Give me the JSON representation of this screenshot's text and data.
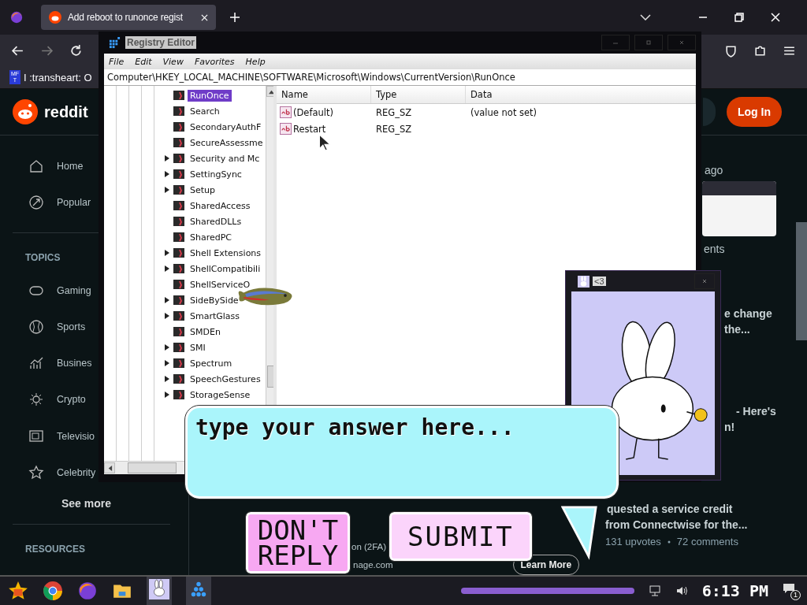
{
  "browser": {
    "tab_title": "Add reboot to runonce regist",
    "bookmark_badge": "MF T",
    "bookmark": "I :transheart: O"
  },
  "reddit": {
    "logo": "reddit",
    "login": "Log In",
    "nav": [
      {
        "label": "Home"
      },
      {
        "label": "Popular"
      }
    ],
    "topics_title": "TOPICS",
    "topics": [
      {
        "label": "Gaming"
      },
      {
        "label": "Sports"
      },
      {
        "label": "Busines"
      },
      {
        "label": "Crypto"
      },
      {
        "label": "Televisio"
      },
      {
        "label": "Celebrity"
      }
    ],
    "see_more": "See more",
    "resources_title": "RESOURCES",
    "feed_fragments": [
      {
        "text": "ago"
      },
      {
        "text": "ents"
      },
      {
        "text": "e change"
      },
      {
        "text": "the..."
      },
      {
        "text": "- Here's"
      },
      {
        "text": "n!"
      },
      {
        "text": "quested a service credit"
      },
      {
        "text": "from Connectwise for the..."
      }
    ],
    "feed_meta": [
      "131 upvotes",
      "72 comments"
    ],
    "ad": {
      "line": "on (2FA)",
      "domain": "nage.com",
      "button": "Learn More"
    }
  },
  "registry": {
    "title": "Registry Editor",
    "menu": [
      "File",
      "Edit",
      "View",
      "Favorites",
      "Help"
    ],
    "address": "Computer\\HKEY_LOCAL_MACHINE\\SOFTWARE\\Microsoft\\Windows\\CurrentVersion\\RunOnce",
    "tree": [
      {
        "label": "RunOnce",
        "expandable": false,
        "selected": true
      },
      {
        "label": "Search",
        "expandable": false,
        "selected": false
      },
      {
        "label": "SecondaryAuthF",
        "expandable": false,
        "selected": false
      },
      {
        "label": "SecureAssessme",
        "expandable": false,
        "selected": false
      },
      {
        "label": "Security and Mc",
        "expandable": true,
        "selected": false
      },
      {
        "label": "SettingSync",
        "expandable": true,
        "selected": false
      },
      {
        "label": "Setup",
        "expandable": true,
        "selected": false
      },
      {
        "label": "SharedAccess",
        "expandable": false,
        "selected": false
      },
      {
        "label": "SharedDLLs",
        "expandable": false,
        "selected": false
      },
      {
        "label": "SharedPC",
        "expandable": false,
        "selected": false
      },
      {
        "label": "Shell Extensions",
        "expandable": true,
        "selected": false
      },
      {
        "label": "ShellCompatibili",
        "expandable": true,
        "selected": false
      },
      {
        "label": "ShellServiceO",
        "expandable": false,
        "selected": false
      },
      {
        "label": "SideBySide",
        "expandable": true,
        "selected": false
      },
      {
        "label": "SmartGlass",
        "expandable": true,
        "selected": false
      },
      {
        "label": "SMDEn",
        "expandable": false,
        "selected": false
      },
      {
        "label": "SMI",
        "expandable": true,
        "selected": false
      },
      {
        "label": "Spectrum",
        "expandable": true,
        "selected": false
      },
      {
        "label": "SpeechGestures",
        "expandable": true,
        "selected": false
      },
      {
        "label": "StorageSense",
        "expandable": true,
        "selected": false
      }
    ],
    "columns": [
      "Name",
      "Type",
      "Data"
    ],
    "values": [
      {
        "name": "(Default)",
        "type": "REG_SZ",
        "data": "(value not set)"
      },
      {
        "name": "Restart",
        "type": "REG_SZ"
      }
    ]
  },
  "pet_window": {
    "title": "<3"
  },
  "prompt": {
    "placeholder": "type your answer here...",
    "buttons": [
      {
        "label": "DON'T REPLY",
        "kind": "dismiss"
      },
      {
        "label": "SUBMIT",
        "kind": "submit"
      }
    ]
  },
  "taskbar": {
    "time": "6:13 PM",
    "notifications": "1"
  }
}
